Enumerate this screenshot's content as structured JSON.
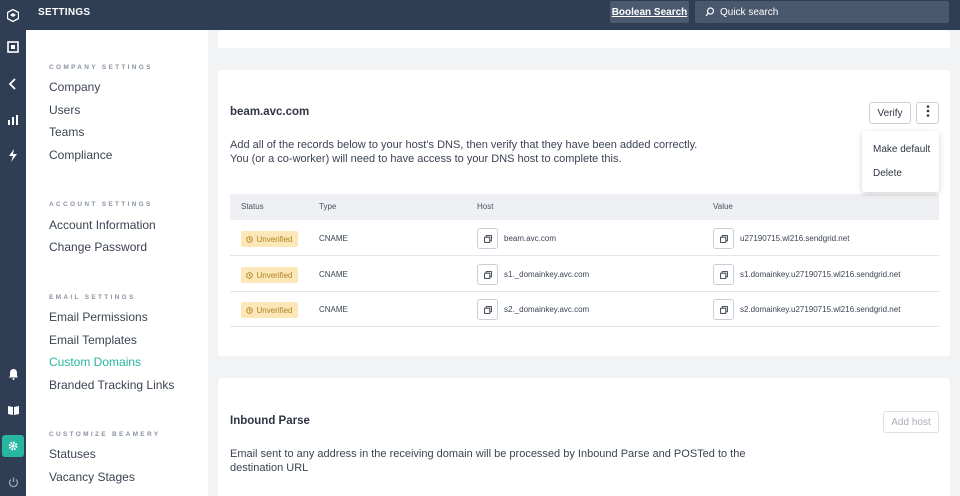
{
  "app": {
    "section_title": "SETTINGS",
    "boolean_search_label": "Boolean Search",
    "quick_search_placeholder": "Quick search",
    "accent_color": "#27b6a0",
    "topbar_color": "#2f3e55"
  },
  "rail": {
    "icons": [
      "logo-icon",
      "dashboard-icon",
      "collapse-icon",
      "stats-icon",
      "activity-icon",
      "notifications-icon",
      "book-icon",
      "settings-icon",
      "power-icon"
    ]
  },
  "nav": {
    "company_settings": {
      "title": "COMPANY SETTINGS",
      "items": [
        "Company",
        "Users",
        "Teams",
        "Compliance"
      ]
    },
    "account_settings": {
      "title": "ACCOUNT SETTINGS",
      "items": [
        "Account Information",
        "Change Password"
      ]
    },
    "email_settings": {
      "title": "EMAIL SETTINGS",
      "items": [
        "Email Permissions",
        "Email Templates",
        "Custom Domains",
        "Branded Tracking Links"
      ],
      "active": "Custom Domains"
    },
    "customize": {
      "title": "CUSTOMIZE BEAMERY",
      "items": [
        "Statuses",
        "Vacancy Stages"
      ]
    }
  },
  "domain": {
    "name": "beam.avc.com",
    "verify_label": "Verify",
    "description_line1": "Add all of the records below to your host’s DNS, then verify that they have been added correctly.",
    "description_line2": "You (or a co-worker) will need to have access to your DNS host to complete this.",
    "menu": [
      "Make default",
      "Delete"
    ],
    "columns": [
      "Status",
      "Type",
      "Host",
      "Value"
    ],
    "records": [
      {
        "status": "Unverified",
        "type": "CNAME",
        "host": "beam.avc.com",
        "value": "u27190715.wl216.sendgrid.net"
      },
      {
        "status": "Unverified",
        "type": "CNAME",
        "host": "s1._domainkey.avc.com",
        "value": "s1.domainkey.u27190715.wl216.sendgrid.net"
      },
      {
        "status": "Unverified",
        "type": "CNAME",
        "host": "s2._domainkey.avc.com",
        "value": "s2.domainkey.u27190715.wl216.sendgrid.net"
      }
    ]
  },
  "inbound_parse": {
    "title": "Inbound Parse",
    "add_host_label": "Add host",
    "description": "Email sent to any address in the receiving domain will be processed by Inbound Parse and POSTed to the destination URL"
  }
}
